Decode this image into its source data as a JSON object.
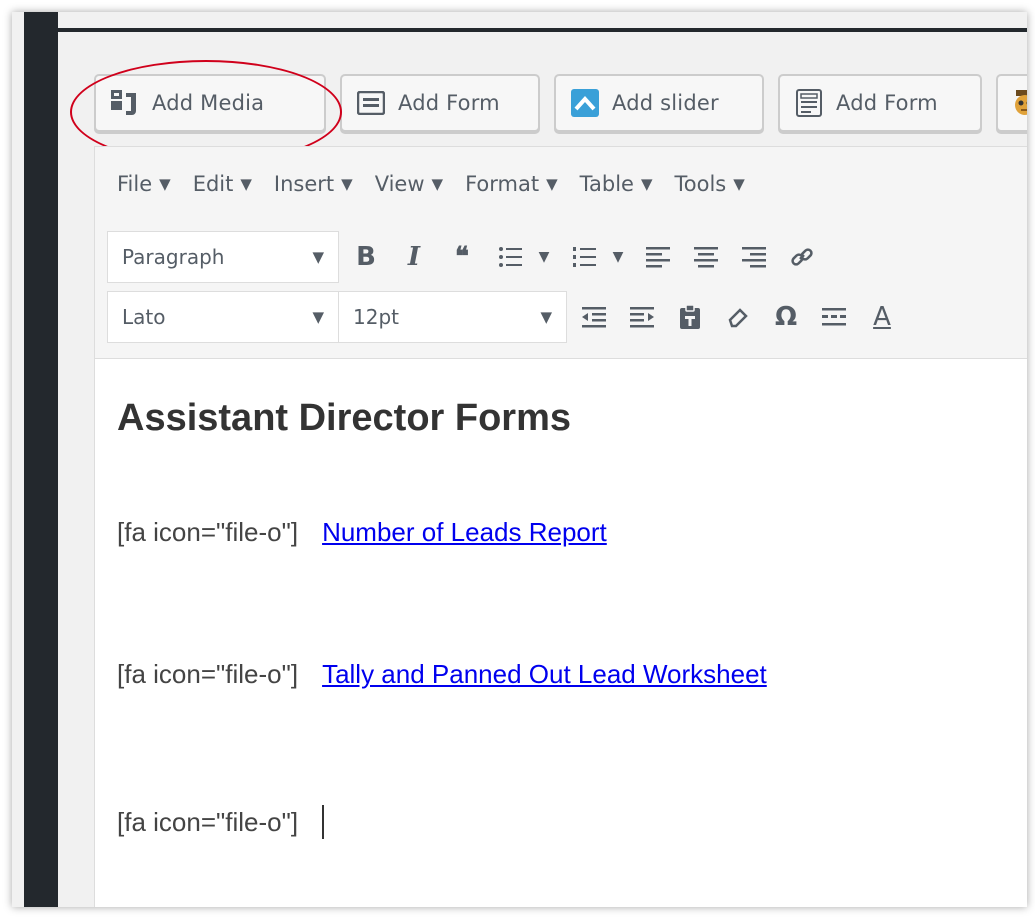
{
  "media_buttons": [
    {
      "label": "Add Media",
      "icon": "add-media-icon"
    },
    {
      "label": "Add Form",
      "icon": "form-icon"
    },
    {
      "label": "Add slider",
      "icon": "slider-icon"
    },
    {
      "label": "Add Form",
      "icon": "form-list-icon"
    }
  ],
  "menubar": [
    "File",
    "Edit",
    "Insert",
    "View",
    "Format",
    "Table",
    "Tools"
  ],
  "toolbar": {
    "block_format": "Paragraph",
    "font_family": "Lato",
    "font_size": "12pt",
    "glyphs": {
      "bold": "B",
      "italic": "I",
      "blockquote": "❝",
      "omega": "Ω",
      "text_color": "A",
      "dropdown": "▼"
    }
  },
  "content": {
    "heading": "Assistant Director Forms",
    "lines": [
      {
        "shortcode": "[fa icon=\"file-o\"]",
        "link": "Number of Leads Report"
      },
      {
        "shortcode": "[fa icon=\"file-o\"]",
        "link": "Tally and Panned Out Lead Worksheet"
      },
      {
        "shortcode": "[fa icon=\"file-o\"]",
        "link": ""
      }
    ]
  },
  "colors": {
    "admin_dark": "#23282d",
    "button_text": "#555d66",
    "link": "#0000ee",
    "annotation": "#d0001b",
    "slider_icon": "#3aa0d8"
  }
}
